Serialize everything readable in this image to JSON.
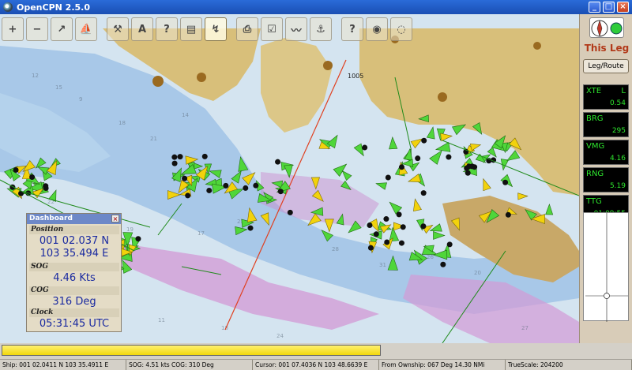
{
  "window": {
    "title": "OpenCPN 2.5.0",
    "minimize_label": "_",
    "maximize_label": "□",
    "close_label": "×"
  },
  "colors": {
    "titlebar": "#1a4fb4",
    "ais_target": "#4fd63a",
    "ais_target_alt": "#f2d20c",
    "land": "#d8bf7a",
    "shallow": "#a8c8e8",
    "restricted": "#cc88cc",
    "route": "#e04020"
  },
  "toolbar": {
    "buttons": [
      {
        "name": "zoom-in-button",
        "icon": "zoom-in-icon",
        "glyph": "+"
      },
      {
        "name": "zoom-out-button",
        "icon": "zoom-out-icon",
        "glyph": "−"
      },
      {
        "name": "scale-in-button",
        "icon": "scale-in-icon",
        "glyph": "↗"
      },
      {
        "name": "ship-button",
        "icon": "ship-icon",
        "glyph": "⛵"
      },
      {
        "name": "settings-button",
        "icon": "wrench-icon",
        "glyph": "⚒"
      },
      {
        "name": "text-button",
        "icon": "text-icon",
        "glyph": "A"
      },
      {
        "name": "help-button",
        "icon": "question-icon",
        "glyph": "?"
      },
      {
        "name": "layers-button",
        "icon": "layers-icon",
        "glyph": "▤"
      },
      {
        "name": "route-button",
        "icon": "route-icon",
        "glyph": "↯"
      },
      {
        "name": "print-button",
        "icon": "printer-icon",
        "glyph": "⎙"
      },
      {
        "name": "check-button",
        "icon": "checklist-icon",
        "glyph": "☑"
      },
      {
        "name": "track-button",
        "icon": "track-icon",
        "glyph": "〰"
      },
      {
        "name": "anchor-button",
        "icon": "anchor-icon",
        "glyph": "⚓"
      },
      {
        "name": "info-button",
        "icon": "book-icon",
        "glyph": "?"
      },
      {
        "name": "ais-button",
        "icon": "ais-icon",
        "glyph": "◉"
      },
      {
        "name": "mob-button",
        "icon": "lifebuoy-icon",
        "glyph": "◌"
      }
    ]
  },
  "route_labels": [
    "1005"
  ],
  "sidepanel": {
    "leg_title": "This Leg",
    "leg_button": "Leg/Route",
    "instruments": [
      {
        "label": "XTE",
        "unit": "L",
        "value": "0.54"
      },
      {
        "label": "BRG",
        "unit": "",
        "value": "295"
      },
      {
        "label": "VMG",
        "unit": "",
        "value": "4.16"
      },
      {
        "label": "RNG",
        "unit": "",
        "value": "5.19"
      },
      {
        "label": "TTG",
        "unit": "",
        "value": "01:09:55"
      }
    ]
  },
  "dashboard": {
    "title": "Dashboard",
    "close_label": "×",
    "position_label": "Position",
    "lat": "001 02.037 N",
    "lon": "103 35.494 E",
    "sog_label": "SOG",
    "sog_value": "4.46 Kts",
    "cog_label": "COG",
    "cog_value": "316 Deg",
    "clock_label": "Clock",
    "clock_value": "05:31:45 UTC"
  },
  "progress": {
    "fraction": 1.0
  },
  "status": {
    "ship": "Ship: 001 02.0411 N   103 35.4911 E",
    "sog": "SOG:  4.51 kts  COG:   310 Deg",
    "cursor": "Cursor: 001 07.4036 N 103 48.6639 E",
    "ownship": "From Ownship: 067 Deg   14.30 NMi",
    "truescale": "TrueScale:    204200"
  }
}
